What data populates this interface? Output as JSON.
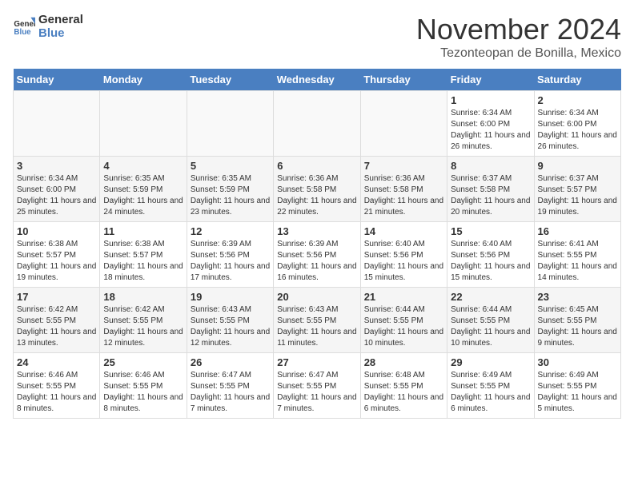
{
  "header": {
    "logo_general": "General",
    "logo_blue": "Blue",
    "month": "November 2024",
    "location": "Tezonteopan de Bonilla, Mexico"
  },
  "days_of_week": [
    "Sunday",
    "Monday",
    "Tuesday",
    "Wednesday",
    "Thursday",
    "Friday",
    "Saturday"
  ],
  "weeks": [
    [
      {
        "day": "",
        "info": ""
      },
      {
        "day": "",
        "info": ""
      },
      {
        "day": "",
        "info": ""
      },
      {
        "day": "",
        "info": ""
      },
      {
        "day": "",
        "info": ""
      },
      {
        "day": "1",
        "info": "Sunrise: 6:34 AM\nSunset: 6:00 PM\nDaylight: 11 hours and 26 minutes."
      },
      {
        "day": "2",
        "info": "Sunrise: 6:34 AM\nSunset: 6:00 PM\nDaylight: 11 hours and 26 minutes."
      }
    ],
    [
      {
        "day": "3",
        "info": "Sunrise: 6:34 AM\nSunset: 6:00 PM\nDaylight: 11 hours and 25 minutes."
      },
      {
        "day": "4",
        "info": "Sunrise: 6:35 AM\nSunset: 5:59 PM\nDaylight: 11 hours and 24 minutes."
      },
      {
        "day": "5",
        "info": "Sunrise: 6:35 AM\nSunset: 5:59 PM\nDaylight: 11 hours and 23 minutes."
      },
      {
        "day": "6",
        "info": "Sunrise: 6:36 AM\nSunset: 5:58 PM\nDaylight: 11 hours and 22 minutes."
      },
      {
        "day": "7",
        "info": "Sunrise: 6:36 AM\nSunset: 5:58 PM\nDaylight: 11 hours and 21 minutes."
      },
      {
        "day": "8",
        "info": "Sunrise: 6:37 AM\nSunset: 5:58 PM\nDaylight: 11 hours and 20 minutes."
      },
      {
        "day": "9",
        "info": "Sunrise: 6:37 AM\nSunset: 5:57 PM\nDaylight: 11 hours and 19 minutes."
      }
    ],
    [
      {
        "day": "10",
        "info": "Sunrise: 6:38 AM\nSunset: 5:57 PM\nDaylight: 11 hours and 19 minutes."
      },
      {
        "day": "11",
        "info": "Sunrise: 6:38 AM\nSunset: 5:57 PM\nDaylight: 11 hours and 18 minutes."
      },
      {
        "day": "12",
        "info": "Sunrise: 6:39 AM\nSunset: 5:56 PM\nDaylight: 11 hours and 17 minutes."
      },
      {
        "day": "13",
        "info": "Sunrise: 6:39 AM\nSunset: 5:56 PM\nDaylight: 11 hours and 16 minutes."
      },
      {
        "day": "14",
        "info": "Sunrise: 6:40 AM\nSunset: 5:56 PM\nDaylight: 11 hours and 15 minutes."
      },
      {
        "day": "15",
        "info": "Sunrise: 6:40 AM\nSunset: 5:56 PM\nDaylight: 11 hours and 15 minutes."
      },
      {
        "day": "16",
        "info": "Sunrise: 6:41 AM\nSunset: 5:55 PM\nDaylight: 11 hours and 14 minutes."
      }
    ],
    [
      {
        "day": "17",
        "info": "Sunrise: 6:42 AM\nSunset: 5:55 PM\nDaylight: 11 hours and 13 minutes."
      },
      {
        "day": "18",
        "info": "Sunrise: 6:42 AM\nSunset: 5:55 PM\nDaylight: 11 hours and 12 minutes."
      },
      {
        "day": "19",
        "info": "Sunrise: 6:43 AM\nSunset: 5:55 PM\nDaylight: 11 hours and 12 minutes."
      },
      {
        "day": "20",
        "info": "Sunrise: 6:43 AM\nSunset: 5:55 PM\nDaylight: 11 hours and 11 minutes."
      },
      {
        "day": "21",
        "info": "Sunrise: 6:44 AM\nSunset: 5:55 PM\nDaylight: 11 hours and 10 minutes."
      },
      {
        "day": "22",
        "info": "Sunrise: 6:44 AM\nSunset: 5:55 PM\nDaylight: 11 hours and 10 minutes."
      },
      {
        "day": "23",
        "info": "Sunrise: 6:45 AM\nSunset: 5:55 PM\nDaylight: 11 hours and 9 minutes."
      }
    ],
    [
      {
        "day": "24",
        "info": "Sunrise: 6:46 AM\nSunset: 5:55 PM\nDaylight: 11 hours and 8 minutes."
      },
      {
        "day": "25",
        "info": "Sunrise: 6:46 AM\nSunset: 5:55 PM\nDaylight: 11 hours and 8 minutes."
      },
      {
        "day": "26",
        "info": "Sunrise: 6:47 AM\nSunset: 5:55 PM\nDaylight: 11 hours and 7 minutes."
      },
      {
        "day": "27",
        "info": "Sunrise: 6:47 AM\nSunset: 5:55 PM\nDaylight: 11 hours and 7 minutes."
      },
      {
        "day": "28",
        "info": "Sunrise: 6:48 AM\nSunset: 5:55 PM\nDaylight: 11 hours and 6 minutes."
      },
      {
        "day": "29",
        "info": "Sunrise: 6:49 AM\nSunset: 5:55 PM\nDaylight: 11 hours and 6 minutes."
      },
      {
        "day": "30",
        "info": "Sunrise: 6:49 AM\nSunset: 5:55 PM\nDaylight: 11 hours and 5 minutes."
      }
    ]
  ]
}
